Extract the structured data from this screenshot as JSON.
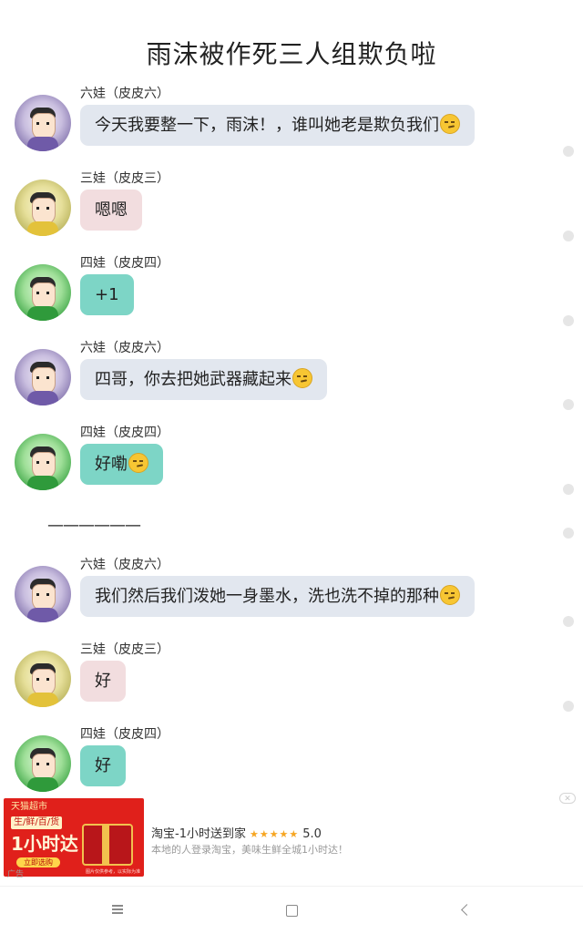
{
  "page": {
    "title": "雨沫被作死三人组欺负啦"
  },
  "messages": [
    {
      "sender": "六娃（皮皮六）",
      "text": "今天我要整一下，雨沫！，谁叫她老是欺负我们",
      "emoji": "smirk-emoji",
      "avatar": "six"
    },
    {
      "sender": "三娃（皮皮三）",
      "text": "嗯嗯",
      "avatar": "three"
    },
    {
      "sender": "四娃（皮皮四）",
      "text": "+1",
      "avatar": "four"
    },
    {
      "sender": "六娃（皮皮六）",
      "text": "四哥，你去把她武器藏起来",
      "emoji": "smirk-emoji",
      "avatar": "six"
    },
    {
      "sender": "四娃（皮皮四）",
      "text": "好嘞",
      "emoji": "smirk-emoji",
      "avatar": "four"
    },
    {
      "sender": "六娃（皮皮六）",
      "text": "我们然后我们泼她一身墨水，洗也洗不掉的那种",
      "emoji": "smirk-emoji",
      "avatar": "six"
    },
    {
      "sender": "三娃（皮皮三）",
      "text": "好",
      "avatar": "three"
    },
    {
      "sender": "四娃（皮皮四）",
      "text": "好",
      "avatar": "four"
    }
  ],
  "separator": "——————",
  "colors": {
    "bubble_six": "#e2e7ef",
    "bubble_three": "#f2dddf",
    "bubble_four": "#7dd5c6"
  },
  "ad": {
    "image": {
      "brand": "天猫超市",
      "chip": "生/鲜/百/货",
      "headline": "1小时达",
      "cta": "立即选购",
      "disclaimer": "图片仅供参考，以实际为准"
    },
    "label": "广告",
    "title": "淘宝-1小时送到家",
    "stars": "★★★★★",
    "rating": "5.0",
    "description": "本地的人登录淘宝，美味生鲜全城1小时达！",
    "close_icon": "close-icon"
  },
  "navbar": {
    "menu_icon": "menu-icon",
    "home_icon": "home-icon",
    "back_icon": "back-icon"
  }
}
